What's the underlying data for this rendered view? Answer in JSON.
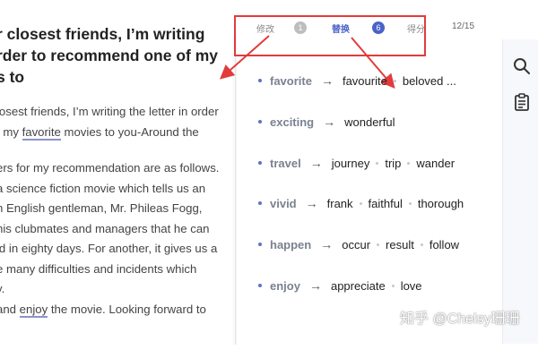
{
  "essay": {
    "title_lines": [
      "r closest friends, I’m writing",
      "rder to recommend one of my",
      "s to"
    ],
    "para1": {
      "line1": "losest friends, I’m writing the letter in order",
      "line2_pre": "f my ",
      "line2_hl": "favorite",
      "line2_post": " movies to you-Around the"
    },
    "para2_lines": [
      "ers for my recommendation are as follows.",
      "a science fiction movie which tells us an",
      "n English gentleman, Mr. Phileas Fogg,",
      " his clubmates and managers that he can",
      "ld in eighty days. For another, it gives us a",
      "e many difficulties and incidents which",
      "y."
    ],
    "para3": {
      "pre": "and ",
      "hl": "enjoy",
      "post": " the movie. Looking forward to"
    }
  },
  "tabs": {
    "revise_label": "修改",
    "revise_count": "1",
    "replace_label": "替换",
    "replace_count": "6",
    "score_label": "得分",
    "progress": "12/15"
  },
  "suggestions": [
    {
      "word": "favorite",
      "alternatives": [
        "favourite",
        "beloved ..."
      ]
    },
    {
      "word": "exciting",
      "alternatives": [
        "wonderful"
      ]
    },
    {
      "word": "travel",
      "alternatives": [
        "journey",
        "trip",
        "wander"
      ]
    },
    {
      "word": "vivid",
      "alternatives": [
        "frank",
        "faithful",
        "thorough"
      ]
    },
    {
      "word": "happen",
      "alternatives": [
        "occur",
        "result",
        "follow"
      ]
    },
    {
      "word": "enjoy",
      "alternatives": [
        "appreciate",
        "love"
      ]
    }
  ],
  "watermark": "知乎 @Chelsy珊珊",
  "colors": {
    "accent": "#4b63c7",
    "annotation": "#e23b3b",
    "badge_inactive": "#bdbdbd"
  },
  "icons": {
    "search": "search-icon",
    "clipboard": "clipboard-icon"
  }
}
